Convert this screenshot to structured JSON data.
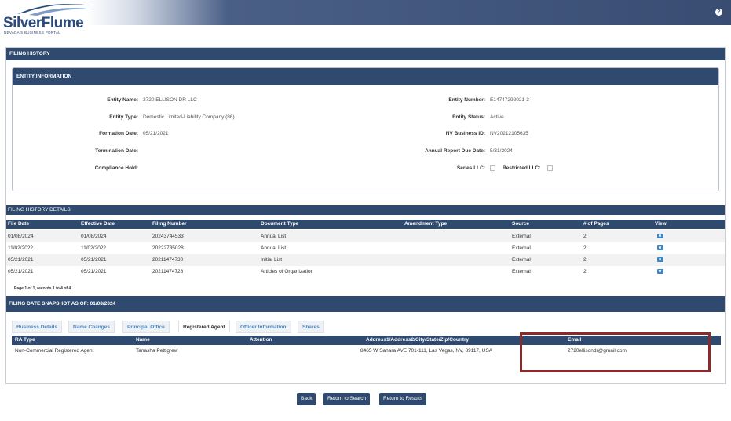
{
  "header": {
    "logo_text": "SilverFlume",
    "logo_sub": "NEVADA'S BUSINESS PORTAL",
    "help_icon": "?"
  },
  "filing_history": {
    "title": "FILING HISTORY"
  },
  "entity": {
    "title": "ENTITY INFORMATION",
    "left": [
      {
        "label": "Entity Name:",
        "value": "2720 ELLISON DR LLC"
      },
      {
        "label": "Entity Type:",
        "value": "Domestic Limited-Liability Company (86)"
      },
      {
        "label": "Formation Date:",
        "value": "05/21/2021"
      },
      {
        "label": "Termination Date:",
        "value": ""
      },
      {
        "label": "Compliance Hold:",
        "value": ""
      }
    ],
    "right": [
      {
        "label": "Entity Number:",
        "value": "E14747292021-3"
      },
      {
        "label": "Entity Status:",
        "value": "Active"
      },
      {
        "label": "NV Business ID:",
        "value": "NV20212105635"
      },
      {
        "label": "Annual Report Due Date:",
        "value": "5/31/2024"
      }
    ],
    "series_llc_label": "Series LLC:",
    "restricted_llc_label": "Restricted LLC:"
  },
  "history_details": {
    "title": "FILING HISTORY DETAILS",
    "columns": [
      "File Date",
      "Effective Date",
      "Filing Number",
      "Document Type",
      "Amendment Type",
      "Source",
      "# of Pages",
      "View"
    ],
    "rows": [
      [
        "01/08/2024",
        "01/08/2024",
        "20243744533",
        "Annual List",
        "",
        "External",
        "2"
      ],
      [
        "11/02/2022",
        "11/02/2022",
        "20222735028",
        "Annual List",
        "",
        "External",
        "2"
      ],
      [
        "05/21/2021",
        "05/21/2021",
        "20211474730",
        "Initial List",
        "",
        "External",
        "2"
      ],
      [
        "05/21/2021",
        "05/21/2021",
        "20211474728",
        "Articles of Organization",
        "",
        "External",
        "2"
      ]
    ],
    "view_icon": "camera-icon",
    "pager": "Page 1 of 1, records 1 to 4 of 4"
  },
  "snapshot": {
    "title": "FILING DATE SNAPSHOT AS OF: 01/08/2024",
    "tabs": [
      "Business Details",
      "Name Changes",
      "Principal Office",
      "Registered Agent",
      "Officer Information",
      "Shares"
    ],
    "active_tab": "Registered Agent",
    "ra_columns": [
      "RA Type",
      "Name",
      "Attention",
      "Address1/Address2/City/State/Zip/Country",
      "Email"
    ],
    "ra_row": [
      "Non-Commercial Registered Agent",
      "Tanasha Pettigrew",
      "",
      "8465 W Sahara AVE 701-111, Las Vegas, NV, 89117, USA",
      "2720ellisondr@gmail.com"
    ]
  },
  "buttons": {
    "back": "Back",
    "return_search": "Return to Search",
    "return_results": "Return to Results"
  },
  "colors": {
    "header_navy": "#2f4a6e",
    "highlight": "#8b2a2a",
    "link_blue": "#4a86c6"
  }
}
